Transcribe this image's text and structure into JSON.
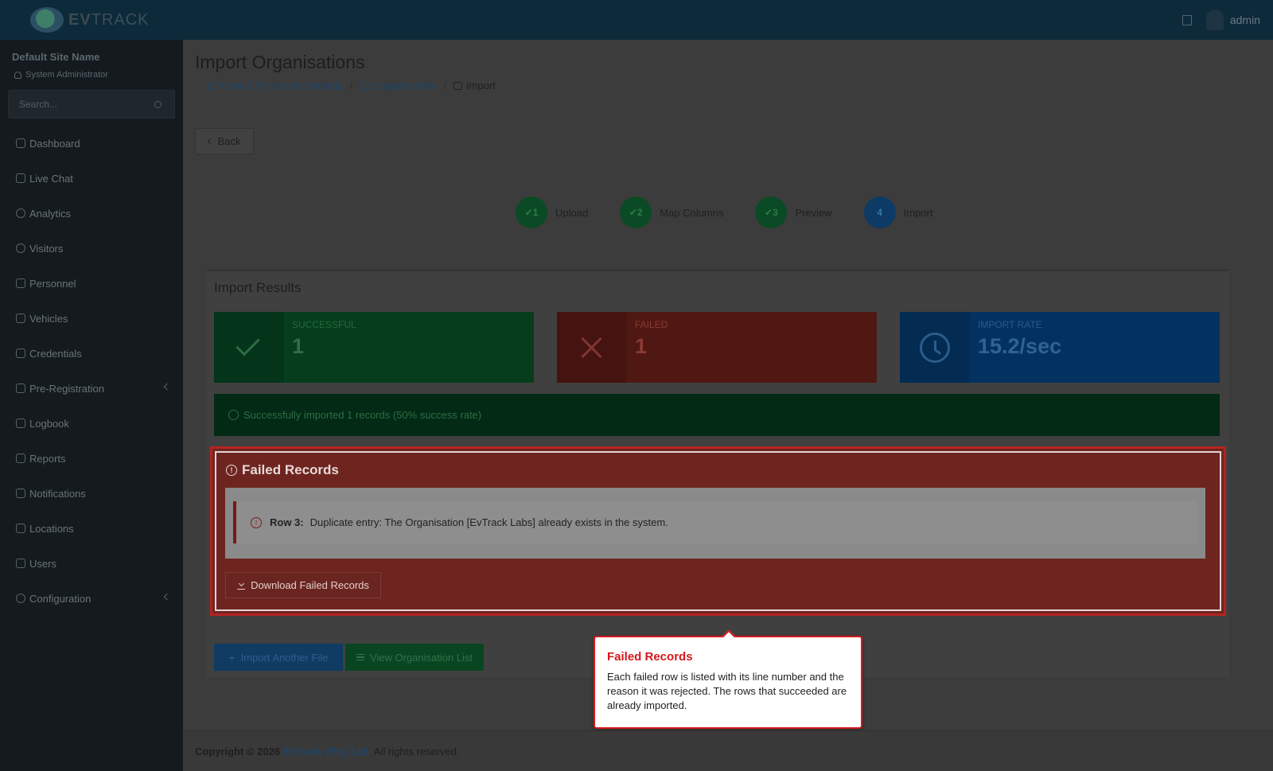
{
  "app": {
    "brand_ev": "EV",
    "brand_track": "TRACK",
    "user": "admin"
  },
  "sidebar": {
    "site_name": "Default Site Name",
    "role": "System Administrator",
    "search_placeholder": "Search...",
    "items": [
      {
        "label": "Dashboard",
        "icon": "dashboard-icon"
      },
      {
        "label": "Live Chat",
        "icon": "headset-icon"
      },
      {
        "label": "Analytics",
        "icon": "target-icon"
      },
      {
        "label": "Visitors",
        "icon": "eye-icon"
      },
      {
        "label": "Personnel",
        "icon": "people-icon"
      },
      {
        "label": "Vehicles",
        "icon": "car-icon"
      },
      {
        "label": "Credentials",
        "icon": "id-card-icon"
      },
      {
        "label": "Pre-Registration",
        "icon": "arrows-icon",
        "has_submenu": true
      },
      {
        "label": "Logbook",
        "icon": "book-icon"
      },
      {
        "label": "Reports",
        "icon": "chart-icon"
      },
      {
        "label": "Notifications",
        "icon": "chat-icon"
      },
      {
        "label": "Locations",
        "icon": "building-icon"
      },
      {
        "label": "Users",
        "icon": "user-gear-icon"
      },
      {
        "label": "Configuration",
        "icon": "gear-icon",
        "has_submenu": true
      }
    ]
  },
  "page": {
    "title": "Import Organisations",
    "breadcrumb": [
      {
        "label": "User & Personnel Settings"
      },
      {
        "label": "Organisations"
      },
      {
        "label": "Import"
      }
    ],
    "back_label": "Back"
  },
  "steps": [
    {
      "number": "1",
      "label": "Upload",
      "state": "done"
    },
    {
      "number": "2",
      "label": "Map Columns",
      "state": "done"
    },
    {
      "number": "3",
      "label": "Preview",
      "state": "done"
    },
    {
      "number": "4",
      "label": "Import",
      "state": "active"
    }
  ],
  "results": {
    "title": "Import Results",
    "successful_label": "SUCCESSFUL",
    "successful_value": "1",
    "failed_label": "FAILED",
    "failed_value": "1",
    "rate_label": "IMPORT RATE",
    "rate_value": "15.2/sec",
    "success_message": "Successfully imported 1 records (50% success rate)"
  },
  "failed_records": {
    "title": "Failed Records",
    "rows": [
      {
        "row_label": "Row 3:",
        "message": "Duplicate entry: The Organisation [EvTrack Labs] already exists in the system."
      }
    ],
    "download_label": "Download Failed Records"
  },
  "actions": {
    "import_another": "Import Another File",
    "view_list": "View Organisation List"
  },
  "tooltip": {
    "title": "Failed Records",
    "body": "Each failed row is listed with its line number and the reason it was rejected. The rows that succeeded are already imported."
  },
  "footer": {
    "copyright": "Copyright © 2026",
    "company": "EvTrack (Pty) Ltd.",
    "rights": "All rights reserved."
  },
  "colors": {
    "success": "#063d1c",
    "failed": "#4f1813",
    "rate": "#043260",
    "tooltip_accent": "#d4181c"
  }
}
